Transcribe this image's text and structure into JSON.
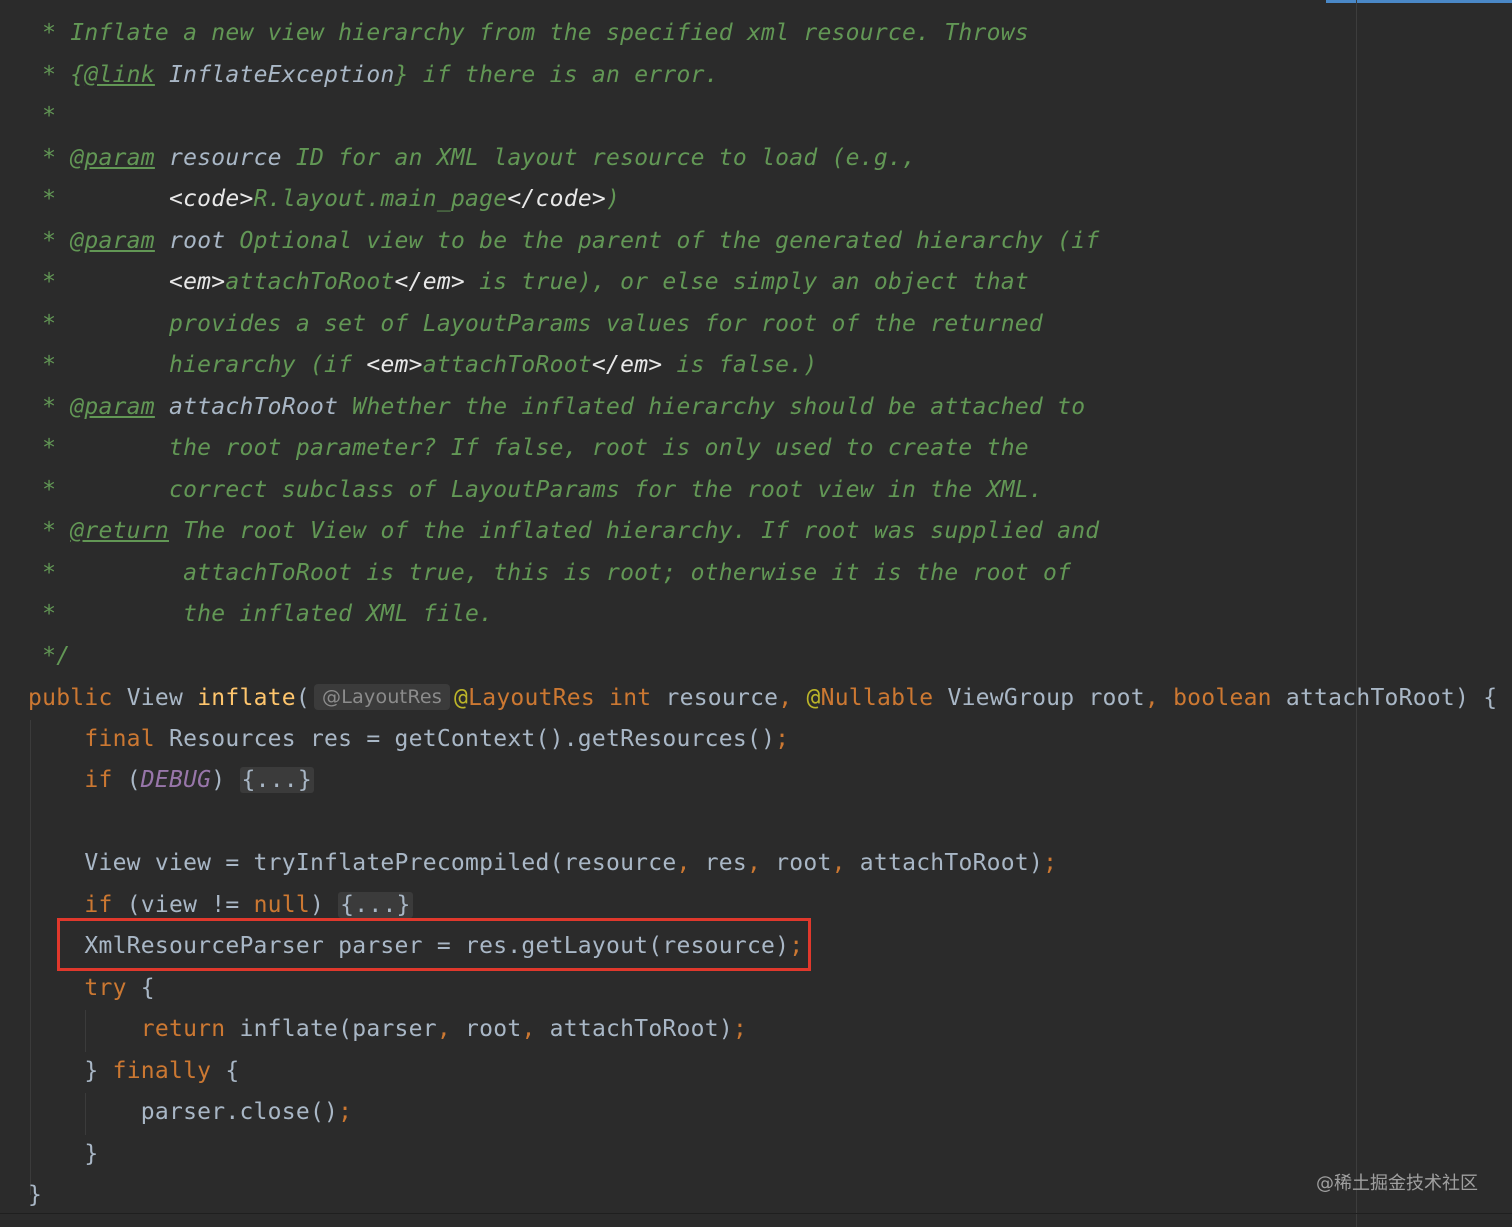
{
  "editor": {
    "comment_lines": [
      [
        {
          "t": " * Inflate a new view hierarchy from the specified xml resource. Throws",
          "c": "doc"
        }
      ],
      [
        {
          "t": " * {",
          "c": "doc"
        },
        {
          "t": "@link",
          "c": "doctag"
        },
        {
          "t": " ",
          "c": "doc"
        },
        {
          "t": "InflateException",
          "c": "docref"
        },
        {
          "t": "} if there is an error.",
          "c": "doc"
        }
      ],
      [
        {
          "t": " *",
          "c": "doc"
        }
      ],
      [
        {
          "t": " * ",
          "c": "doc"
        },
        {
          "t": "@param",
          "c": "doctag"
        },
        {
          "t": " ",
          "c": "doc"
        },
        {
          "t": "resource",
          "c": "param"
        },
        {
          "t": " ID for an XML layout resource to load (e.g.,",
          "c": "doc"
        }
      ],
      [
        {
          "t": " *        ",
          "c": "doc"
        },
        {
          "t": "<code>",
          "c": "html"
        },
        {
          "t": "R.layout.main_page",
          "c": "doc"
        },
        {
          "t": "</code>",
          "c": "html"
        },
        {
          "t": ")",
          "c": "doc"
        }
      ],
      [
        {
          "t": " * ",
          "c": "doc"
        },
        {
          "t": "@param",
          "c": "doctag"
        },
        {
          "t": " ",
          "c": "doc"
        },
        {
          "t": "root",
          "c": "param"
        },
        {
          "t": " Optional view to be the parent of the generated hierarchy (if",
          "c": "doc"
        }
      ],
      [
        {
          "t": " *        ",
          "c": "doc"
        },
        {
          "t": "<em>",
          "c": "html"
        },
        {
          "t": "attachToRoot",
          "c": "doc"
        },
        {
          "t": "</em>",
          "c": "html"
        },
        {
          "t": " is true), or else simply an object that",
          "c": "doc"
        }
      ],
      [
        {
          "t": " *        provides a set of LayoutParams values for root of the returned",
          "c": "doc"
        }
      ],
      [
        {
          "t": " *        hierarchy (if ",
          "c": "doc"
        },
        {
          "t": "<em>",
          "c": "html"
        },
        {
          "t": "attachToRoot",
          "c": "doc"
        },
        {
          "t": "</em>",
          "c": "html"
        },
        {
          "t": " is false.)",
          "c": "doc"
        }
      ],
      [
        {
          "t": " * ",
          "c": "doc"
        },
        {
          "t": "@param",
          "c": "doctag"
        },
        {
          "t": " ",
          "c": "doc"
        },
        {
          "t": "attachToRoot",
          "c": "param"
        },
        {
          "t": " Whether the inflated hierarchy should be attached to",
          "c": "doc"
        }
      ],
      [
        {
          "t": " *        the root parameter? If false, root is only used to create the",
          "c": "doc"
        }
      ],
      [
        {
          "t": " *        correct subclass of LayoutParams for the root view in the XML.",
          "c": "doc"
        }
      ],
      [
        {
          "t": " * ",
          "c": "doc"
        },
        {
          "t": "@return",
          "c": "doctag"
        },
        {
          "t": " The root View of the inflated hierarchy. If root was supplied and",
          "c": "doc"
        }
      ],
      [
        {
          "t": " *         attachToRoot is true, this is root; otherwise it is the root of",
          "c": "doc"
        }
      ],
      [
        {
          "t": " *         the inflated XML file.",
          "c": "doc"
        }
      ],
      [
        {
          "t": " */",
          "c": "doc"
        }
      ]
    ],
    "signature": {
      "pre": [
        {
          "t": "public",
          "c": "kw"
        },
        {
          "t": " View ",
          "c": "plain"
        },
        {
          "t": "inflate",
          "c": "fn"
        },
        {
          "t": "(",
          "c": "plain"
        }
      ],
      "hint": "@LayoutRes",
      "post": [
        {
          "t": "@",
          "c": "annot"
        },
        {
          "t": "LayoutRes",
          "c": "kw"
        },
        {
          "t": " ",
          "c": "plain"
        },
        {
          "t": "int",
          "c": "kw"
        },
        {
          "t": " resource",
          "c": "plain"
        },
        {
          "t": ",",
          "c": "punct"
        },
        {
          "t": " ",
          "c": "plain"
        },
        {
          "t": "@",
          "c": "annot"
        },
        {
          "t": "Nullable",
          "c": "kw"
        },
        {
          "t": " ViewGroup root",
          "c": "plain"
        },
        {
          "t": ",",
          "c": "punct"
        },
        {
          "t": " ",
          "c": "plain"
        },
        {
          "t": "boolean",
          "c": "kw"
        },
        {
          "t": " attachToRoot) {",
          "c": "plain"
        }
      ]
    },
    "body_lines": [
      [
        {
          "t": "    ",
          "c": "plain"
        },
        {
          "t": "final",
          "c": "kw"
        },
        {
          "t": " Resources res = getContext().getResources()",
          "c": "plain"
        },
        {
          "t": ";",
          "c": "punct"
        }
      ],
      [
        {
          "t": "    ",
          "c": "plain"
        },
        {
          "t": "if",
          "c": "kw"
        },
        {
          "t": " (",
          "c": "plain"
        },
        {
          "t": "DEBUG",
          "c": "const"
        },
        {
          "t": ") ",
          "c": "plain"
        },
        {
          "t": "{...}",
          "c": "fold"
        }
      ],
      [],
      [
        {
          "t": "    View view = tryInflatePrecompiled(resource",
          "c": "plain"
        },
        {
          "t": ",",
          "c": "punct"
        },
        {
          "t": " res",
          "c": "plain"
        },
        {
          "t": ",",
          "c": "punct"
        },
        {
          "t": " root",
          "c": "plain"
        },
        {
          "t": ",",
          "c": "punct"
        },
        {
          "t": " attachToRoot)",
          "c": "plain"
        },
        {
          "t": ";",
          "c": "punct"
        }
      ],
      [
        {
          "t": "    ",
          "c": "plain"
        },
        {
          "t": "if",
          "c": "kw"
        },
        {
          "t": " (view != ",
          "c": "plain"
        },
        {
          "t": "null",
          "c": "kw"
        },
        {
          "t": ") ",
          "c": "plain"
        },
        {
          "t": "{...}",
          "c": "fold"
        }
      ],
      [
        {
          "t": "    XmlResourceParser parser = res.getLayout(resource)",
          "c": "plain"
        },
        {
          "t": ";",
          "c": "punct"
        }
      ],
      [
        {
          "t": "    ",
          "c": "plain"
        },
        {
          "t": "try",
          "c": "kw"
        },
        {
          "t": " {",
          "c": "plain"
        }
      ],
      [
        {
          "t": "        ",
          "c": "plain"
        },
        {
          "t": "return",
          "c": "kw"
        },
        {
          "t": " inflate(parser",
          "c": "plain"
        },
        {
          "t": ",",
          "c": "punct"
        },
        {
          "t": " root",
          "c": "plain"
        },
        {
          "t": ",",
          "c": "punct"
        },
        {
          "t": " attachToRoot)",
          "c": "plain"
        },
        {
          "t": ";",
          "c": "punct"
        }
      ],
      [
        {
          "t": "    } ",
          "c": "plain"
        },
        {
          "t": "finally",
          "c": "kw"
        },
        {
          "t": " {",
          "c": "plain"
        }
      ],
      [
        {
          "t": "        parser.close()",
          "c": "plain"
        },
        {
          "t": ";",
          "c": "punct"
        }
      ],
      [
        {
          "t": "    }",
          "c": "plain"
        }
      ],
      [
        {
          "t": "}",
          "c": "plain"
        }
      ]
    ],
    "highlighted_statement": "XmlResourceParser parser = res.getLayout(resource);"
  },
  "watermark": "@稀土掘金技术社区",
  "colors": {
    "background": "#2b2b2b",
    "doc_comment": "#629755",
    "keyword": "#cc7832",
    "plain": "#a9b7c6",
    "function": "#ffc66d",
    "annotation": "#bbb529",
    "constant": "#9876aa",
    "highlight_box": "#e0382c"
  }
}
